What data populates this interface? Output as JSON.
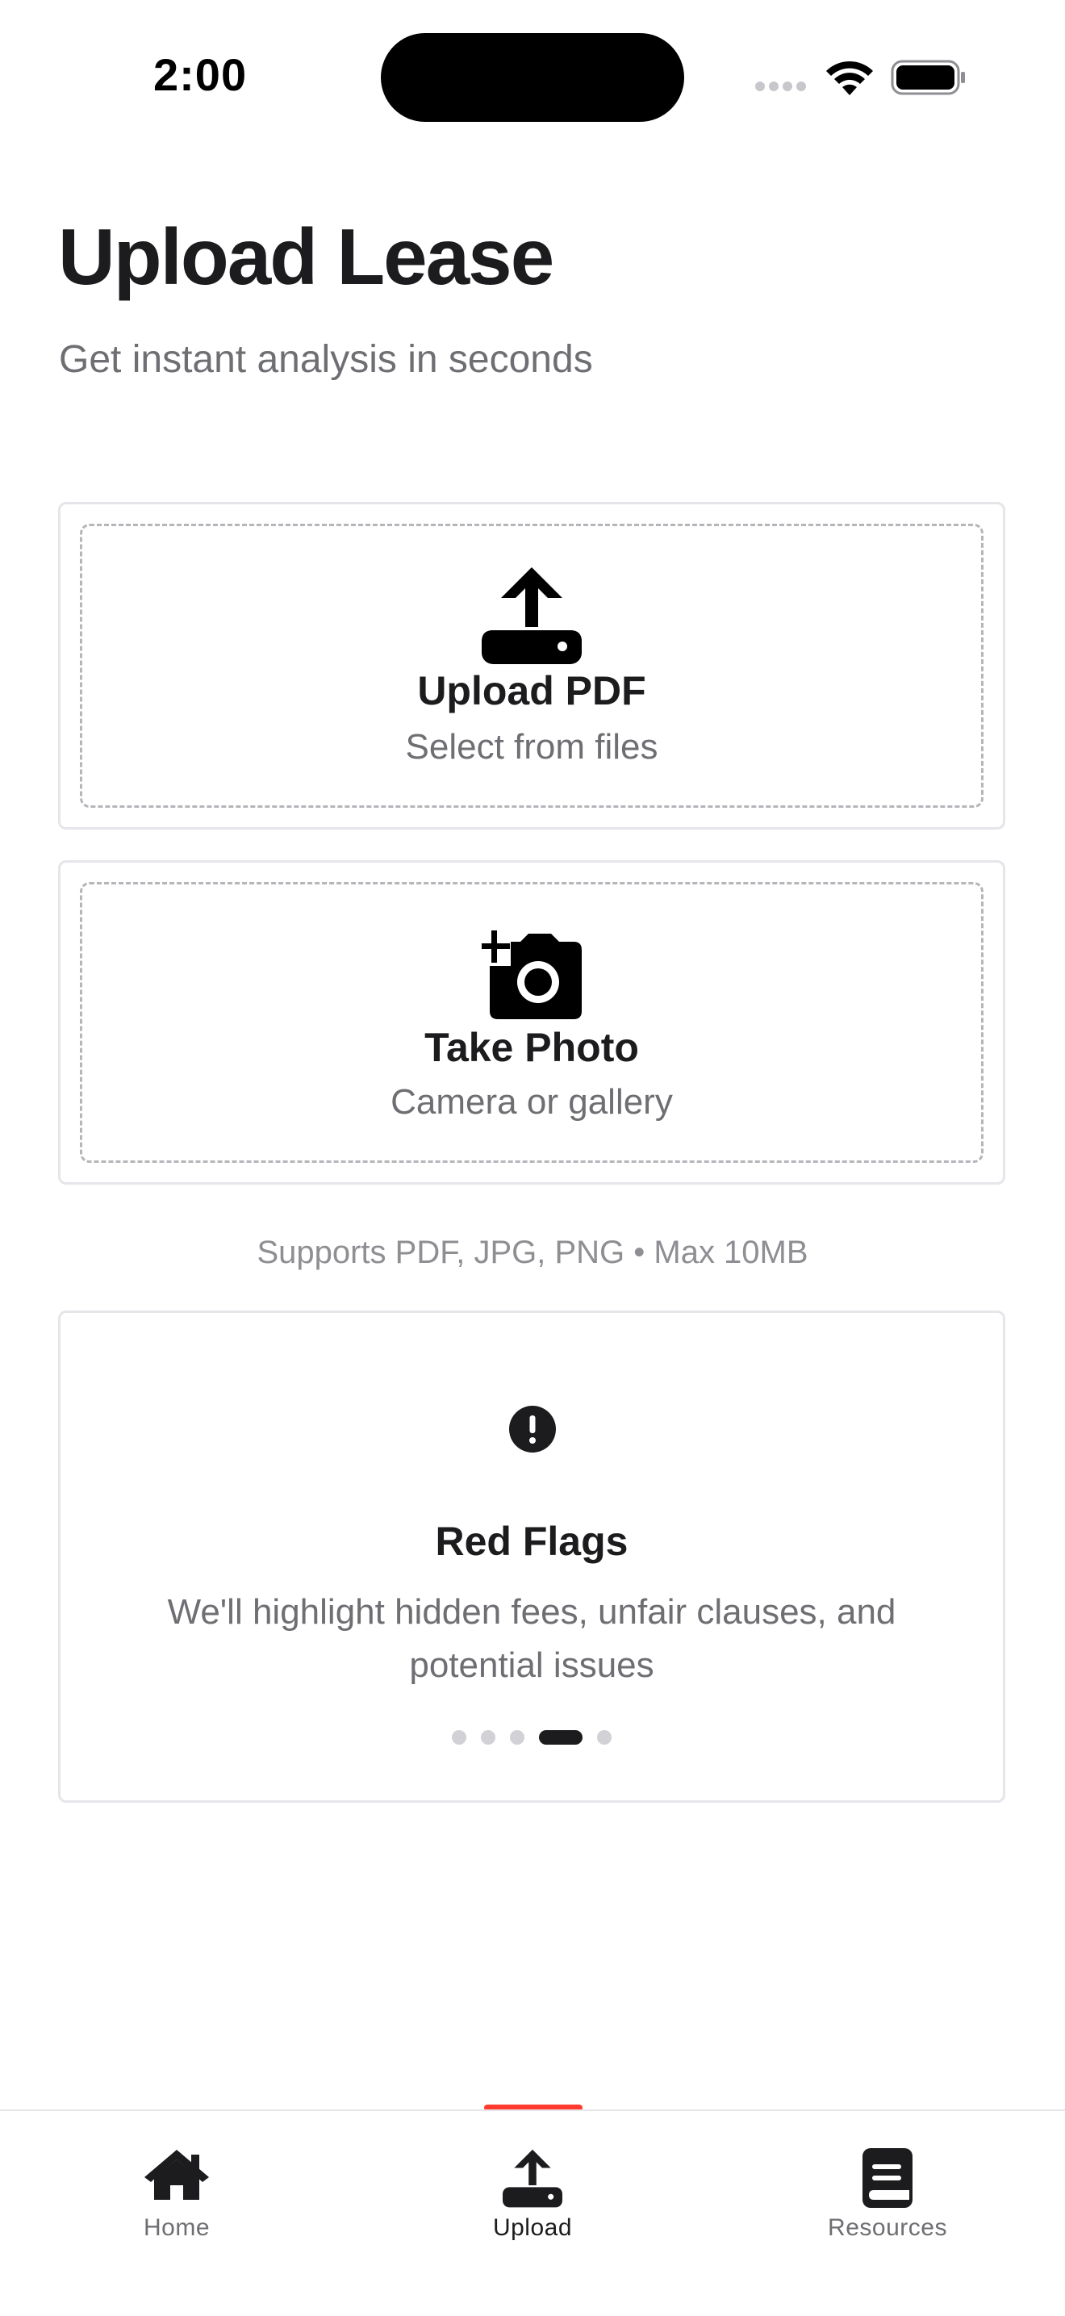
{
  "status_bar": {
    "time": "2:00"
  },
  "header": {
    "title": "Upload Lease",
    "subtitle": "Get instant analysis in seconds"
  },
  "options": {
    "pdf": {
      "icon": "upload-icon",
      "title": "Upload PDF",
      "subtitle": "Select from files"
    },
    "photo": {
      "icon": "camera-plus-icon",
      "title": "Take Photo",
      "subtitle": "Camera or gallery"
    }
  },
  "supports_note": "Supports PDF, JPG, PNG • Max 10MB",
  "info_carousel": {
    "icon": "alert-circle-icon",
    "title": "Red Flags",
    "body": "We'll highlight hidden fees, unfair clauses, and potential issues",
    "page_count": 5,
    "active_page": 4
  },
  "tab_bar": {
    "tabs": [
      {
        "label": "Home",
        "icon": "home-icon"
      },
      {
        "label": "Upload",
        "icon": "upload-icon"
      },
      {
        "label": "Resources",
        "icon": "book-icon"
      }
    ],
    "active_index": 1
  },
  "colors": {
    "accent": "#ff3b30",
    "text_primary": "#1c1c1e",
    "text_secondary": "#6e6e73",
    "border": "#e5e5ea"
  }
}
